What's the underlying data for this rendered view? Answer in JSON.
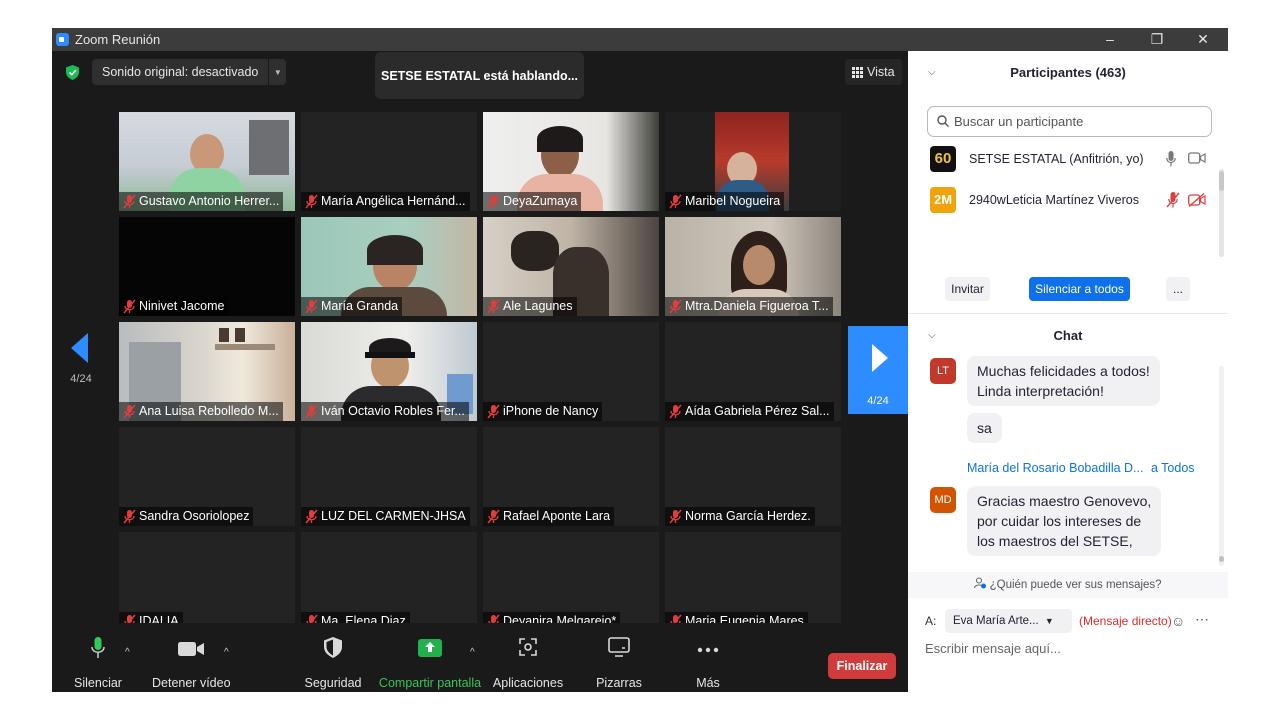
{
  "window": {
    "title": "Zoom Reunión",
    "minimize": "–",
    "restore": "❐",
    "close": "✕"
  },
  "stage": {
    "sound_label": "Sonido original: desactivado",
    "speaking_banner": "SETSE ESTATAL está hablando...",
    "view_label": "Vista",
    "page_indicator": "4/24"
  },
  "tiles": [
    {
      "name": "Gustavo Antonio Herrer...",
      "video": true
    },
    {
      "name": "María Angélica Hernánd...",
      "video": false
    },
    {
      "name": "DeyaZumaya",
      "video": true
    },
    {
      "name": "Maribel Nogueira",
      "video": true
    },
    {
      "name": "Ninivet Jacome",
      "video": false
    },
    {
      "name": "María Granda",
      "video": true
    },
    {
      "name": "Ale Lagunes",
      "video": true
    },
    {
      "name": "Mtra.Daniela Figueroa T...",
      "video": true
    },
    {
      "name": "Ana Luisa Rebolledo M...",
      "video": true
    },
    {
      "name": "Iván Octavio Robles Fer...",
      "video": true
    },
    {
      "name": "iPhone de Nancy",
      "video": false
    },
    {
      "name": "Aída Gabriela Pérez Sal...",
      "video": false
    },
    {
      "name": "Sandra Osoriolopez",
      "video": false
    },
    {
      "name": "LUZ DEL CARMEN-JHSA",
      "video": false
    },
    {
      "name": "Rafael Aponte Lara",
      "video": false
    },
    {
      "name": "Norma García Herdez.",
      "video": false
    },
    {
      "name": "IDALIA",
      "video": false
    },
    {
      "name": "Ma. Elena Diaz",
      "video": false
    },
    {
      "name": "Deyanira Melgarejo*",
      "video": false
    },
    {
      "name": "Maria Eugenia Mares",
      "video": false
    }
  ],
  "toolbar": {
    "mute": "Silenciar",
    "stop_video": "Detener vídeo",
    "security": "Seguridad",
    "share_screen": "Compartir pantalla",
    "apps": "Aplicaciones",
    "whiteboards": "Pizarras",
    "more": "Más",
    "end": "Finalizar"
  },
  "participants": {
    "header": "Participantes (463)",
    "search_placeholder": "Buscar un participante",
    "list": [
      {
        "avatar": "60",
        "name": "SETSE ESTATAL (Anfitrión, yo)",
        "avatar_color": "#111111"
      },
      {
        "avatar": "2M",
        "name": "2940wLeticia Martínez Viveros",
        "avatar_color": "#f0a30a"
      }
    ],
    "invite": "Invitar",
    "mute_all": "Silenciar a todos",
    "more": "..."
  },
  "chat": {
    "header": "Chat",
    "messages": [
      {
        "avatar": "LT",
        "avatar_color": "#c0392b",
        "lines": [
          "Muchas felicidades a todos!",
          "Linda interpretación!"
        ]
      },
      {
        "text": "sa"
      },
      {
        "sender": "María del Rosario Bobadilla D...",
        "to": "a Todos"
      },
      {
        "avatar": "MD",
        "avatar_color": "#d35400",
        "lines": [
          "Gracias maestro Genovevo,",
          "por cuidar los intereses de",
          "los maestros del SETSE,"
        ]
      }
    ],
    "who_can_see": "¿Quién puede ver sus mensajes?",
    "to_label": "A:",
    "recipient": "Eva María Arte...",
    "direct_label": "(Mensaje directo)",
    "compose_placeholder": "Escribir mensaje aquí..."
  }
}
